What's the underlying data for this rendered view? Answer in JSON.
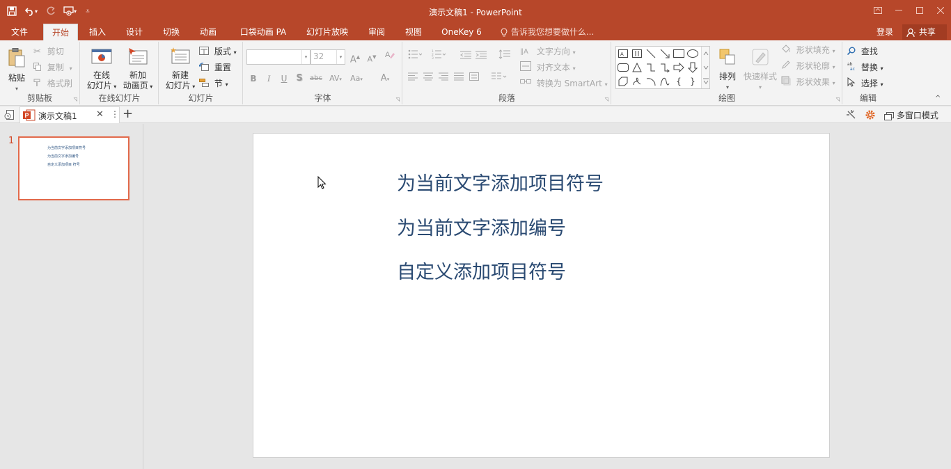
{
  "window": {
    "title": "演示文稿1 - PowerPoint"
  },
  "tabs": {
    "file": "文件",
    "home": "开始",
    "insert": "插入",
    "design": "设计",
    "transitions": "切换",
    "animations": "动画",
    "pocket": "口袋动画 PA",
    "slideshow": "幻灯片放映",
    "review": "审阅",
    "view": "视图",
    "onekey": "OneKey 6",
    "tellme": "告诉我您想要做什么...",
    "login": "登录",
    "share": "共享"
  },
  "ribbon": {
    "clipboard": {
      "label": "剪贴板",
      "paste": "粘贴",
      "cut": "剪切",
      "copy": "复制",
      "format_painter": "格式刷"
    },
    "online_slides": {
      "label": "在线幻灯片",
      "online_line1": "在线",
      "online_line2": "幻灯片",
      "new_anim_line1": "新加",
      "new_anim_line2": "动画页"
    },
    "slides": {
      "label": "幻灯片",
      "new_line1": "新建",
      "new_line2": "幻灯片",
      "layout": "版式",
      "reset": "重置",
      "section": "节"
    },
    "font": {
      "label": "字体",
      "font_name": "",
      "font_size": "32"
    },
    "paragraph": {
      "label": "段落",
      "text_direction": "文字方向",
      "align_text": "对齐文本",
      "convert_smartart": "转换为 SmartArt"
    },
    "drawing": {
      "label": "绘图",
      "arrange": "排列",
      "quick_styles": "快速样式",
      "shape_fill": "形状填充",
      "shape_outline": "形状轮廓",
      "shape_effects": "形状效果"
    },
    "editing": {
      "label": "编辑",
      "find": "查找",
      "replace": "替换",
      "select": "选择"
    }
  },
  "doc_tab": {
    "name": "演示文稿1",
    "multi_window": "多窗口模式"
  },
  "thumbnails": [
    {
      "number": "1",
      "lines": [
        "为当前文字添加项目符号",
        "为当前文字添加编号",
        "自定义添加项目 符号"
      ]
    }
  ],
  "slide": {
    "lines": [
      "为当前文字添加项目符号",
      "为当前文字添加编号",
      "自定义添加项目符号"
    ]
  },
  "colors": {
    "accent": "#b7472a",
    "slide_text": "#2a4a72",
    "thumb_border": "#e2694a"
  }
}
